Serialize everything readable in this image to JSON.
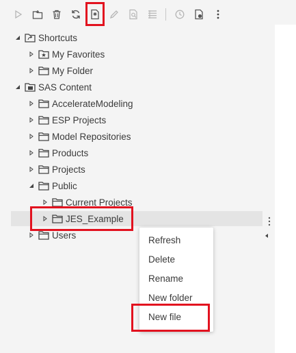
{
  "toolbar": {
    "buttons": [
      {
        "name": "run-icon"
      },
      {
        "name": "new-folder-icon"
      },
      {
        "name": "delete-icon"
      },
      {
        "name": "refresh-icon"
      },
      {
        "name": "new-file-icon"
      },
      {
        "name": "edit-icon"
      },
      {
        "name": "find-icon"
      },
      {
        "name": "list-icon"
      },
      {
        "name": "history-icon"
      },
      {
        "name": "properties-icon"
      },
      {
        "name": "more-icon"
      }
    ]
  },
  "tree": {
    "items": [
      {
        "label": "Shortcuts",
        "expanded": true
      },
      {
        "label": "My Favorites",
        "expanded": false
      },
      {
        "label": "My Folder",
        "expanded": false
      },
      {
        "label": "SAS Content",
        "expanded": true
      },
      {
        "label": "AccelerateModeling",
        "expanded": false
      },
      {
        "label": "ESP Projects",
        "expanded": false
      },
      {
        "label": "Model Repositories",
        "expanded": false
      },
      {
        "label": "Products",
        "expanded": false
      },
      {
        "label": "Projects",
        "expanded": false
      },
      {
        "label": "Public",
        "expanded": true
      },
      {
        "label": "Current Projects",
        "expanded": false
      },
      {
        "label": "JES_Example",
        "expanded": false,
        "selected": true
      },
      {
        "label": "Users",
        "expanded": false
      }
    ]
  },
  "context_menu": {
    "items": [
      "Refresh",
      "Delete",
      "Rename",
      "New folder",
      "New file"
    ]
  },
  "colors": {
    "highlight": "#e2121f",
    "selected_row": "#e4e4e4",
    "icon_gray": "#555555",
    "icon_disabled": "#b5b5b5"
  }
}
